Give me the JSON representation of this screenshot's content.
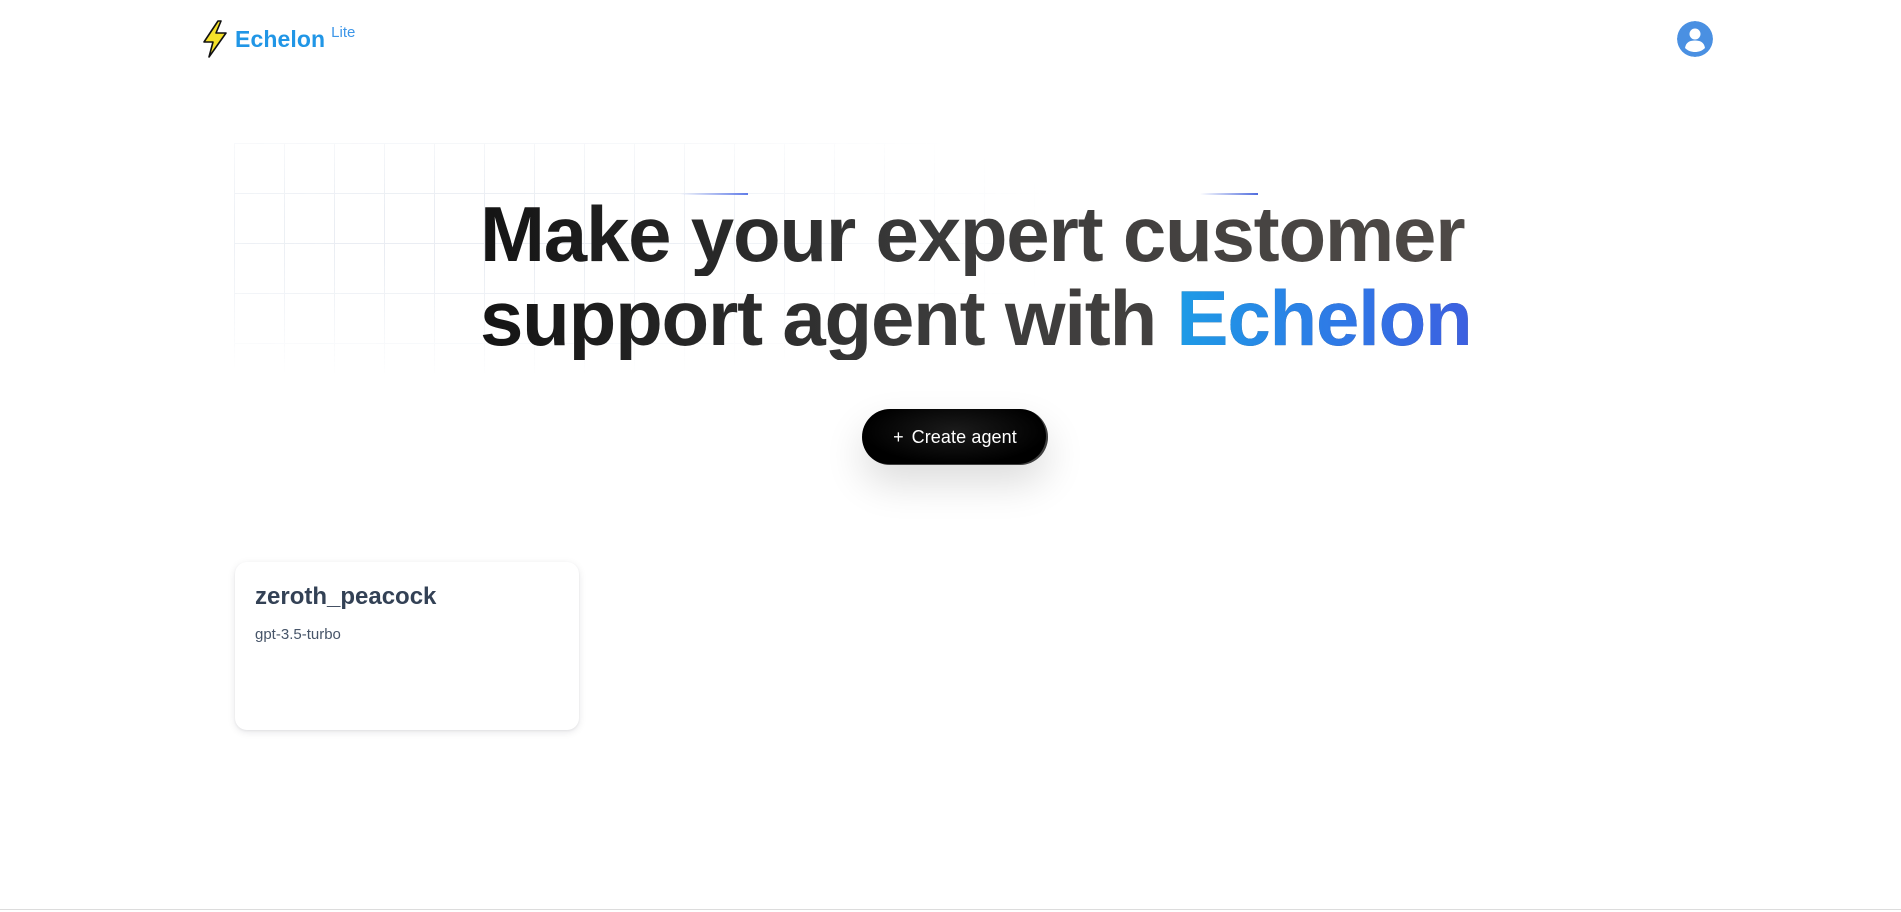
{
  "header": {
    "brand_name": "Echelon",
    "brand_badge": "Lite",
    "logo_icon": "lightning-bolt-icon",
    "account_icon": "user-avatar-icon",
    "colors": {
      "brand": "#2196e6",
      "logo_fill": "#f5e12a",
      "avatar": "#4a90e2"
    }
  },
  "hero": {
    "headline_line1": "Make your expert customer",
    "headline_line2_prefix": "support agent with ",
    "headline_brand": "Echelon",
    "cta_icon": "plus-icon",
    "cta_plus": "+",
    "cta_label": "Create agent"
  },
  "agents": [
    {
      "name": "zeroth_peacock",
      "model": "gpt-3.5-turbo"
    }
  ]
}
